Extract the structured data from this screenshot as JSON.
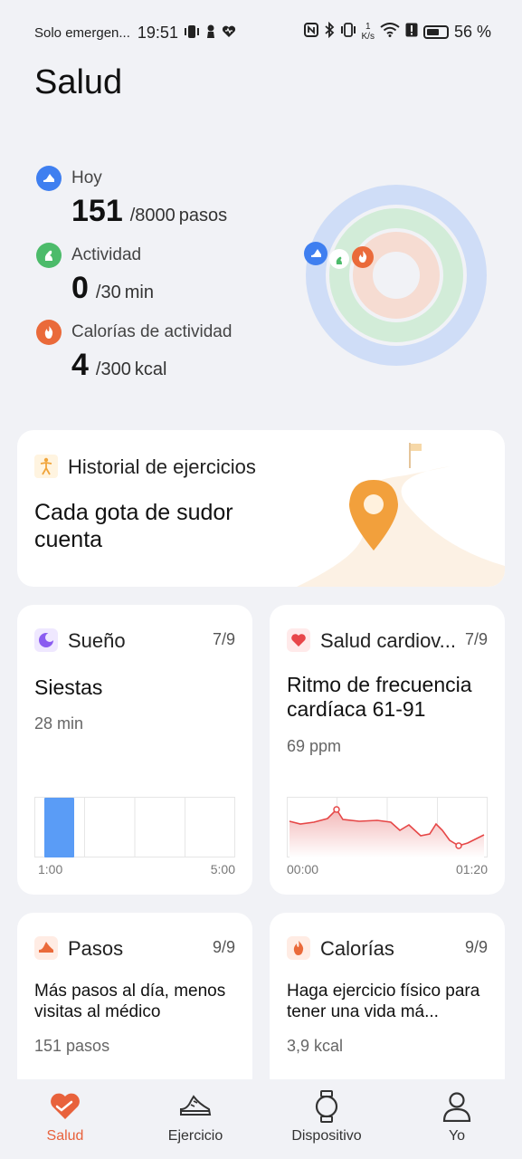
{
  "status_bar": {
    "carrier": "Solo emergen...",
    "time": "19:51",
    "net_speed_top": "1",
    "net_speed_bottom": "K/s",
    "battery": "56 %"
  },
  "title": "Salud",
  "summary": {
    "steps": {
      "label": "Hoy",
      "value": "151",
      "goal": "/8000",
      "unit": "pasos",
      "fraction": 0.019
    },
    "activity": {
      "label": "Actividad",
      "value": "0",
      "goal": "/30",
      "unit": "min",
      "fraction": 0.0
    },
    "calories": {
      "label": "Calorías de actividad",
      "value": "4",
      "goal": "/300",
      "unit": "kcal",
      "fraction": 0.013
    }
  },
  "colors": {
    "steps": "#3f7ff0",
    "activity": "#4cbb6a",
    "calories": "#ea6a3a",
    "accent": "#e8623c"
  },
  "history_card": {
    "title": "Historial de ejercicios",
    "subtitle": "Cada gota de sudor cuenta"
  },
  "sleep_card": {
    "title": "Sueño",
    "date": "7/9",
    "main": "Siestas",
    "sub": "28 min",
    "x_start": "1:00",
    "x_end": "5:00"
  },
  "heart_card": {
    "title": "Salud cardiov...",
    "date": "7/9",
    "main": "Ritmo de frecuencia cardíaca 61-91",
    "sub": "69 ppm",
    "x_start": "00:00",
    "x_end": "01:20"
  },
  "steps_card": {
    "title": "Pasos",
    "date": "9/9",
    "main": "Más pasos al día, menos visitas al médico",
    "sub": "151 pasos"
  },
  "calories_card": {
    "title": "Calorías",
    "date": "9/9",
    "main": "Haga ejercicio físico para tener una vida má...",
    "sub": "3,9 kcal"
  },
  "nav": [
    {
      "label": "Salud",
      "icon": "heart-icon",
      "active": true
    },
    {
      "label": "Ejercicio",
      "icon": "shoe-icon",
      "active": false
    },
    {
      "label": "Dispositivo",
      "icon": "watch-icon",
      "active": false
    },
    {
      "label": "Yo",
      "icon": "person-icon",
      "active": false
    }
  ]
}
